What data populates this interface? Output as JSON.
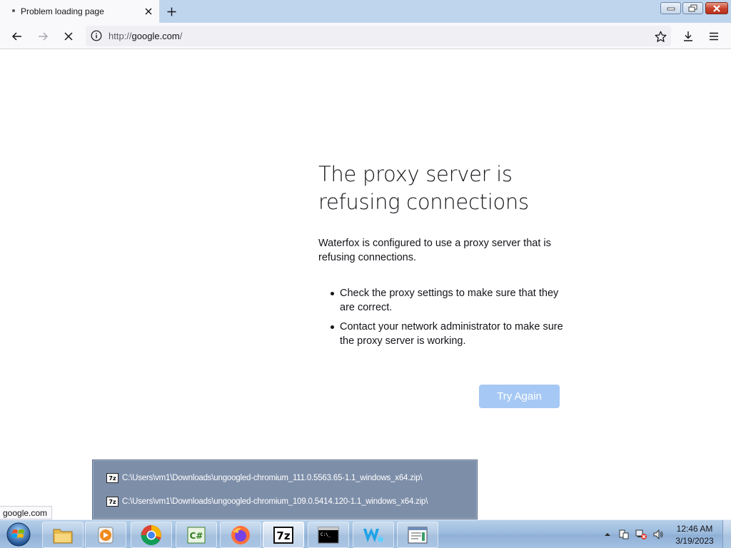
{
  "browser": {
    "tab": {
      "title": "Problem loading page"
    },
    "url": {
      "prefix": "http://",
      "host": "google.com",
      "suffix": "/"
    },
    "status_link": "google.com"
  },
  "error_page": {
    "title": "The proxy server is refusing connections",
    "description": "Waterfox is configured to use a proxy server that is refusing connections.",
    "suggestions": [
      "Check the proxy settings to make sure that they are correct.",
      "Contact your network administrator to make sure the proxy server is working."
    ],
    "try_again_label": "Try Again"
  },
  "jump_list": {
    "items": [
      {
        "icon_label": "7z",
        "path": "C:\\Users\\vm1\\Downloads\\ungoogled-chromium_111.0.5563.65-1.1_windows_x64.zip\\"
      },
      {
        "icon_label": "7z",
        "path": "C:\\Users\\vm1\\Downloads\\ungoogled-chromium_109.0.5414.120-1.1_windows_x64.zip\\"
      }
    ]
  },
  "taskbar": {
    "apps": [
      {
        "name": "file-explorer",
        "icon": "folder-icon"
      },
      {
        "name": "media-player",
        "icon": "media-player-icon"
      },
      {
        "name": "chrome",
        "icon": "chrome-icon"
      },
      {
        "name": "csharp",
        "icon": "csharp-icon",
        "label": "C#"
      },
      {
        "name": "firefox",
        "icon": "firefox-icon"
      },
      {
        "name": "7zip",
        "icon": "7zip-icon",
        "label": "7z"
      },
      {
        "name": "cmd",
        "icon": "terminal-icon",
        "label": "C:\\_"
      },
      {
        "name": "waterfox",
        "icon": "waterfox-icon"
      },
      {
        "name": "notepad",
        "icon": "document-window-icon"
      }
    ],
    "clock": {
      "time": "12:46 AM",
      "date": "3/19/2023"
    }
  },
  "colors": {
    "try_again_bg": "#a6c8f4",
    "taskbar": "#9cbbdd",
    "jump_list_bg": "#7d8ea9"
  }
}
